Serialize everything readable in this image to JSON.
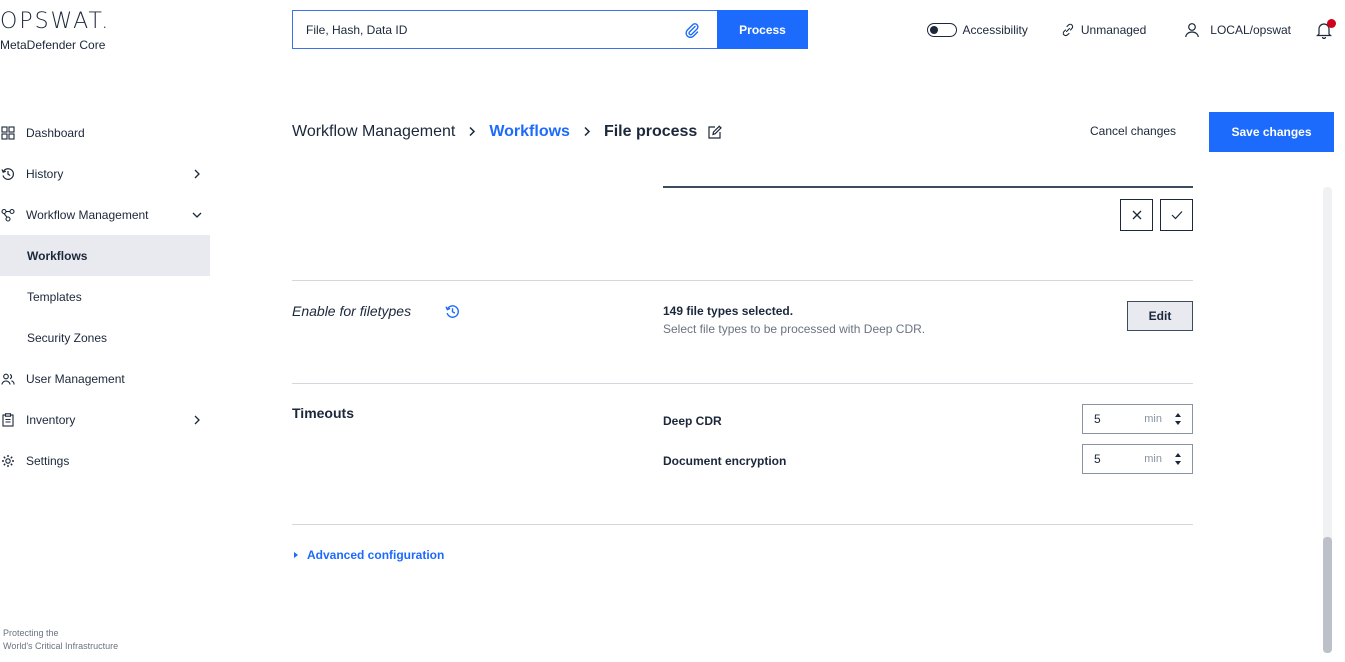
{
  "logo": {
    "brand": "OPSWAT.",
    "product": "MetaDefender Core"
  },
  "search": {
    "placeholder": "File, Hash, Data ID",
    "process_label": "Process"
  },
  "topbar": {
    "accessibility": "Accessibility",
    "unmanaged": "Unmanaged",
    "user": "LOCAL/opswat"
  },
  "sidebar": {
    "items": [
      {
        "label": "Dashboard",
        "icon": "dashboard-icon"
      },
      {
        "label": "History",
        "icon": "history-icon"
      },
      {
        "label": "Workflow Management",
        "icon": "workflow-icon"
      },
      {
        "label": "Workflows"
      },
      {
        "label": "Templates"
      },
      {
        "label": "Security Zones"
      },
      {
        "label": "User Management",
        "icon": "users-icon"
      },
      {
        "label": "Inventory",
        "icon": "clipboard-icon"
      },
      {
        "label": "Settings",
        "icon": "gear-icon"
      }
    ],
    "tagline_1": "Protecting the",
    "tagline_2": "World's Critical Infrastructure"
  },
  "breadcrumb": {
    "root": "Workflow Management",
    "link": "Workflows",
    "current": "File process"
  },
  "actions": {
    "cancel": "Cancel changes",
    "save": "Save changes"
  },
  "filetypes": {
    "title": "Enable for filetypes",
    "count": "149 file types selected.",
    "description": "Select file types to be processed with Deep CDR.",
    "edit_label": "Edit"
  },
  "timeouts": {
    "title": "Timeouts",
    "rows": [
      {
        "label": "Deep CDR",
        "value": "5",
        "unit": "min"
      },
      {
        "label": "Document encryption",
        "value": "5",
        "unit": "min"
      }
    ]
  },
  "advanced": {
    "label": "Advanced configuration"
  },
  "colors": {
    "accent": "#1d6bfc",
    "notification": "#d0021b",
    "text": "#1b273a"
  }
}
